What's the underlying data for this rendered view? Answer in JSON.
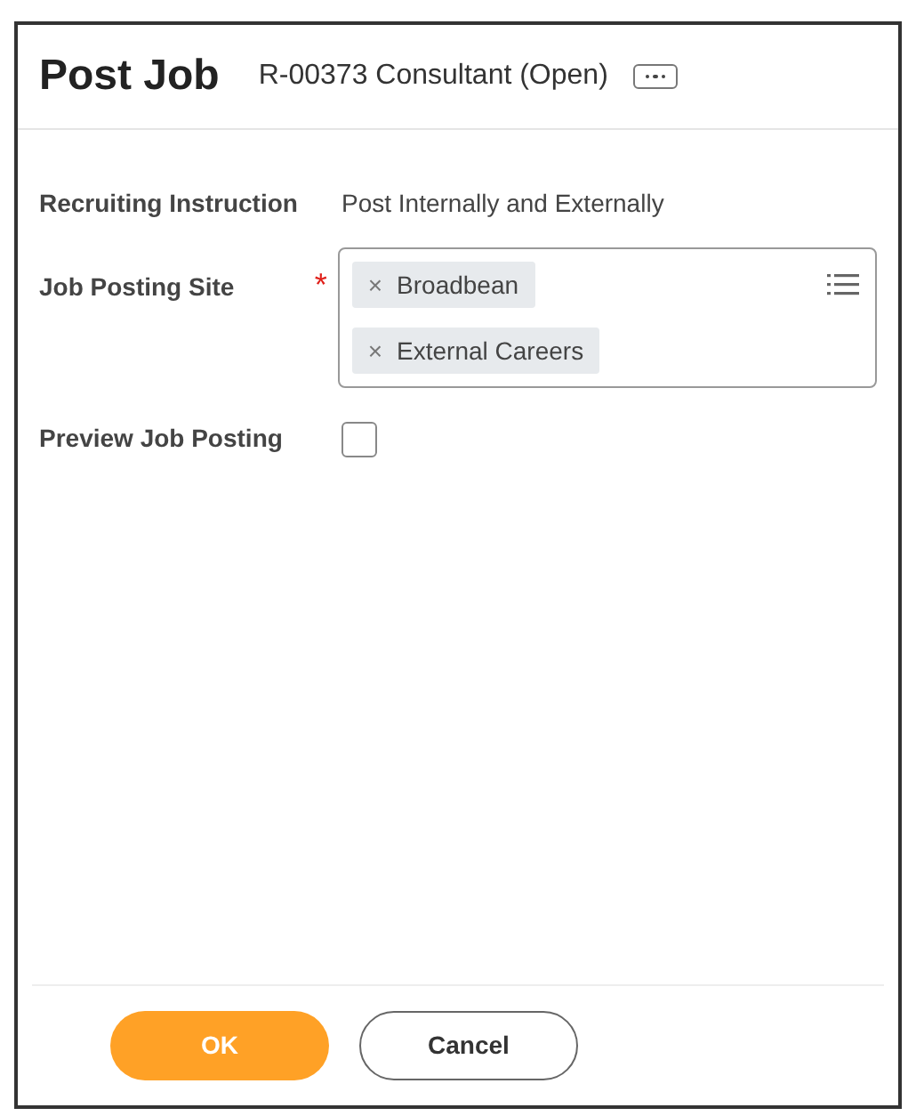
{
  "header": {
    "title": "Post Job",
    "subtitle": "R-00373 Consultant (Open)"
  },
  "fields": [
    {
      "kind": "text",
      "label": "Recruiting Instruction",
      "value": "Post Internally and Externally"
    },
    {
      "kind": "multiselect",
      "label": "Job Posting Site",
      "required_mark": "*",
      "chips": [
        {
          "label": "Broadbean",
          "remove": "×"
        },
        {
          "label": "External Careers",
          "remove": "×"
        }
      ]
    },
    {
      "kind": "checkbox",
      "label": "Preview Job Posting",
      "checked": false
    }
  ],
  "buttons": [
    {
      "label": "OK",
      "kind": "primary"
    },
    {
      "label": "Cancel",
      "kind": "secondary"
    }
  ]
}
